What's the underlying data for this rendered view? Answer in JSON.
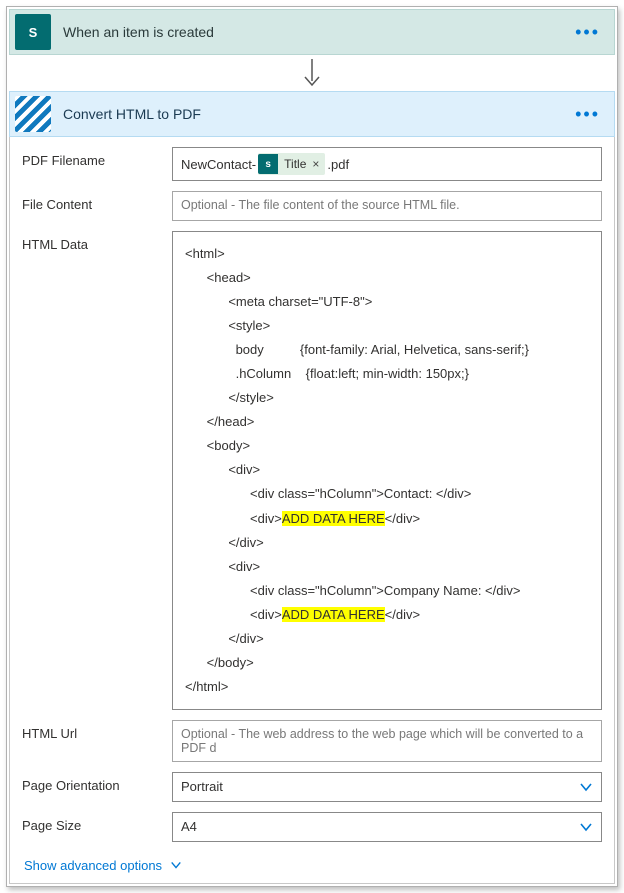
{
  "trigger": {
    "title": "When an item is created",
    "icon": "sharepoint-icon",
    "icon_letter": "S"
  },
  "action": {
    "title": "Convert HTML to PDF",
    "icon": "encodian-icon"
  },
  "fields": {
    "pdf_filename_label": "PDF Filename",
    "pdf_filename_prefix": "NewContact-",
    "pdf_filename_token": "Title",
    "pdf_filename_suffix": ".pdf",
    "file_content_label": "File Content",
    "file_content_placeholder": "Optional - The file content of the source HTML file.",
    "html_data_label": "HTML Data",
    "html_url_label": "HTML Url",
    "html_url_placeholder": "Optional - The web address to the web page which will be converted to a PDF d",
    "page_orientation_label": "Page Orientation",
    "page_orientation_value": "Portrait",
    "page_size_label": "Page Size",
    "page_size_value": "A4"
  },
  "html_code": {
    "l1": "<html>",
    "l2": "<head>",
    "l3": "<meta charset=\"UTF-8\">",
    "l4": "<style>",
    "l5": "body          {font-family: Arial, Helvetica, sans-serif;}",
    "l6": ".hColumn    {float:left; min-width: 150px;}",
    "l7": "</style>",
    "l8": "</head>",
    "l9": "<body>",
    "l10": "<div>",
    "l11a": "<div class=\"hColumn\">Contact: </div>",
    "l11b_pre": "<div>",
    "l11b_hl": "ADD DATA HERE",
    "l11b_post": "</div>",
    "l12": "</div>",
    "l13": "<div>",
    "l14a": "<div class=\"hColumn\">Company Name: </div>",
    "l14b_pre": "<div>",
    "l14b_hl": "ADD DATA HERE",
    "l14b_post": "</div>",
    "l15": "</div>",
    "l16": "</body>",
    "l17": "</html>"
  },
  "advanced_link": "Show advanced options"
}
